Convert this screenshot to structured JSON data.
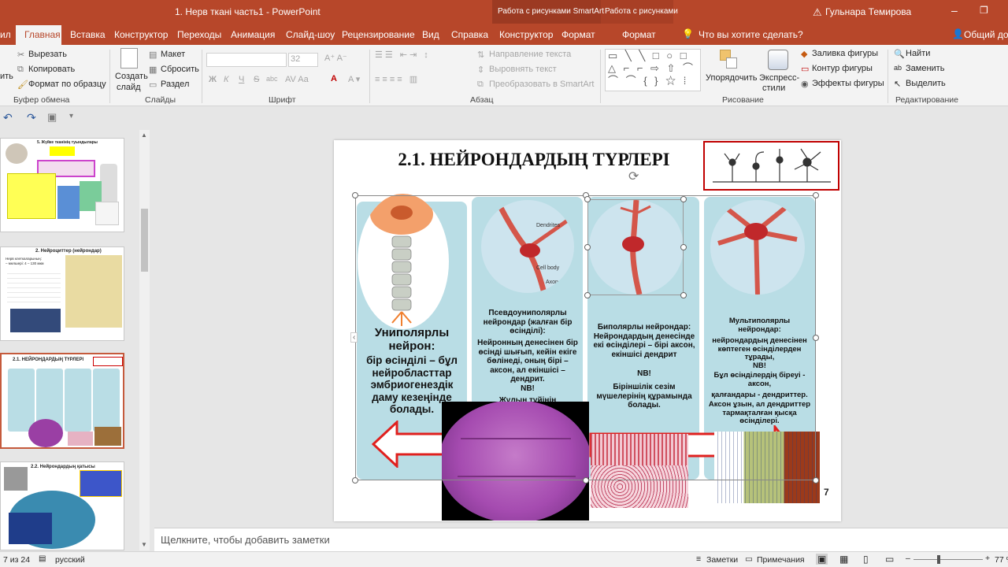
{
  "window": {
    "title": "1. Нерв ткані часть1  -  PowerPoint",
    "context_smartart": "Работа с рисунками SmartArt",
    "context_picture": "Работа с рисунками",
    "user": "Гульнара Темирова"
  },
  "tabs": [
    "Главная",
    "Вставка",
    "Конструктор",
    "Переходы",
    "Анимация",
    "Слайд-шоу",
    "Рецензирование",
    "Вид",
    "Справка",
    "Конструктор",
    "Формат",
    "Формат"
  ],
  "tab_fragment": "ил",
  "tell_me": "Что вы хотите сделать?",
  "share": "Общий дос",
  "clipboard": {
    "cut": "Вырезать",
    "copy": "Копировать",
    "format_painter": "Формат по образцу",
    "paste": "ить",
    "label": "Буфер обмена"
  },
  "slides": {
    "new_slide": "Создать",
    "new_slide2": "слайд",
    "layout": "Макет",
    "reset": "Сбросить",
    "section": "Раздел",
    "label": "Слайды"
  },
  "font": {
    "size": "32",
    "bold": "Ж",
    "italic": "К",
    "underline": "Ч",
    "strike": "S",
    "shadow": "abc",
    "label": "Шрифт"
  },
  "paragraph": {
    "text_direction": "Направление текста",
    "align_text": "Выровнять текст",
    "convert_smartart": "Преобразовать в SmartArt",
    "label": "Абзац"
  },
  "drawing": {
    "arrange": "Упорядочить",
    "quick_styles": "Экспресс-",
    "quick_styles2": "стили",
    "fill": "Заливка фигуры",
    "outline": "Контур фигуры",
    "effects": "Эффекты фигуры",
    "label": "Рисование"
  },
  "editing": {
    "find": "Найти",
    "replace": "Заменить",
    "select": "Выделить",
    "label": "Редактирование"
  },
  "thumbs": [
    {
      "title": "5. Жүйке тканінің туындылары"
    },
    {
      "title": "2. Нейроциттер (нейрондар)",
      "line1": "Нерв клеткаларының:",
      "line2": "– мөлшері: 4 – 130 мкм"
    },
    {
      "title": "2.1. НЕЙРОНДАРДЫҢ ТҮРЛЕРІ"
    },
    {
      "title": "2.2. Нейрондардың қатысы"
    }
  ],
  "slide": {
    "title": "2.1. НЕЙРОНДАРДЫҢ ТҮРЛЕРІ",
    "p1": {
      "head": "Униполярлы нейрон:",
      "body": "бір өсінділі – бұл нейробласттар эмбриогенездік даму кезеңінде болады."
    },
    "p2": {
      "head": "Псевдоуниполярлы нейрондар (жалған бір өсінділі):",
      "body": "Нейронның денесінен бір өсінді шығып, кейін екіге бөлінеді, оның бірі – аксон, ал екіншісі – дендрит.",
      "nb": "NB!",
      "cut": "Жұлын түйінің"
    },
    "p3": {
      "head": "Биполярлы нейрондар: Нейрондардың денесінде екі өсінділері – бірі аксон, екіншісі дендрит",
      "nb": "NB!",
      "body": "Біріншілік сезім мүшелерінің құрамында болады."
    },
    "p4": {
      "head": "Мультиполярлы нейрондар:",
      "body": "нейрондардың денесінен көптеген өсінділерден тұрады,",
      "nb": "NB!",
      "l1": "Бұл өсінділердің біреуі - аксон,",
      "l2": "қалғандары - дендриттер.",
      "l3": "Аксон ұзын, ал дендриттер тармақталған қысқа өсінділері."
    },
    "page_number": "7",
    "labels": {
      "dendrites": "Dendrites",
      "cellbody": "Cell body",
      "axon": "Axon"
    }
  },
  "notes_placeholder": "Щелкните, чтобы добавить заметки",
  "status": {
    "slide": "Слайд 7 из 24",
    "slide_short": "7 из 24",
    "lang": "русский",
    "notes": "Заметки",
    "comments": "Примечания",
    "zoom": "77 %"
  }
}
